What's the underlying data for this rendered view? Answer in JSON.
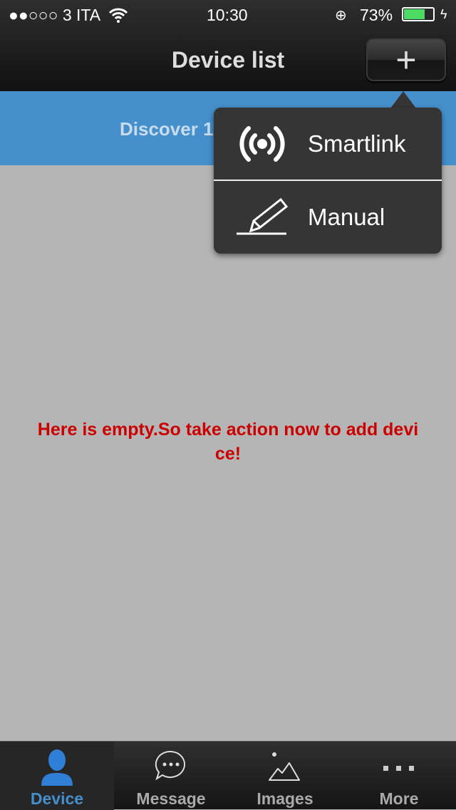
{
  "status": {
    "carrier": "●●○○○ 3 ITA",
    "time": "10:30",
    "battery": "73%",
    "battery_level": 0.73
  },
  "header": {
    "title": "Device list",
    "add_icon": "plus-icon"
  },
  "banner": {
    "text": "Discover 1"
  },
  "popup": {
    "items": [
      {
        "label": "Smartlink",
        "icon": "broadcast-icon"
      },
      {
        "label": "Manual",
        "icon": "pencil-icon"
      }
    ]
  },
  "main": {
    "empty_message": "Here is empty.So take action now to add device!"
  },
  "tabs": [
    {
      "label": "Device",
      "icon": "user-icon",
      "active": true
    },
    {
      "label": "Message",
      "icon": "chat-bubble-icon"
    },
    {
      "label": "Images",
      "icon": "mountain-icon"
    },
    {
      "label": "More",
      "icon": "more-icon"
    }
  ],
  "colors": {
    "accent": "#4590cc",
    "empty_text": "#cc0000",
    "battery": "#4cd964"
  }
}
